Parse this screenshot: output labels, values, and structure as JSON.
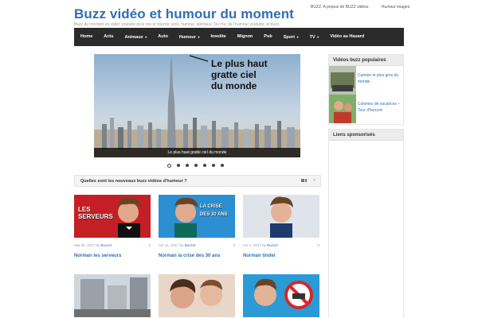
{
  "header": {
    "site_title": "Buzz vidéo et humour du moment",
    "tagline": "Buzz du moment en vidéo youtube pour rire et sourire, actu, humour, animaux. Du rire, de l'humour youtube, et buzz.",
    "top_links": [
      "BUZZ: A propos de BUZZ vidéos",
      "Humour images"
    ]
  },
  "nav": {
    "items": [
      {
        "label": "Home",
        "dropdown": false
      },
      {
        "label": "Actu",
        "dropdown": false
      },
      {
        "label": "Animaux",
        "dropdown": true
      },
      {
        "label": "Auto",
        "dropdown": false
      },
      {
        "label": "Humour",
        "dropdown": true
      },
      {
        "label": "Insolite",
        "dropdown": false
      },
      {
        "label": "Mignon",
        "dropdown": false
      },
      {
        "label": "Pub",
        "dropdown": false
      },
      {
        "label": "Sport",
        "dropdown": true
      },
      {
        "label": "TV",
        "dropdown": true
      },
      {
        "label": "Vidéo au Hasard",
        "dropdown": false
      }
    ],
    "caret": "▾"
  },
  "slider": {
    "callout": [
      "Le plus haut",
      "gratte ciel",
      "du monde"
    ],
    "caption": "Le plus haut gratte ciel du monde",
    "slide_count": 7,
    "active_index": 0
  },
  "section": {
    "title": "Quelles sont les nouveaux buzz vidéos d'humour ?"
  },
  "cards": [
    {
      "date": "Mai 30, 2017",
      "by": "by",
      "author": "Buzzer",
      "comments": "0",
      "title": "Norman les serveurs",
      "overlay": "LES SERVEURS"
    },
    {
      "date": "Avr 21, 2017",
      "by": "by",
      "author": "Buzzer",
      "comments": "0",
      "title": "Norman la crise des 30 ans",
      "overlay": "LA CRISE DES 30 ANS"
    },
    {
      "date": "Avr 1, 2017",
      "by": "by",
      "author": "Buzzer",
      "comments": "0",
      "title": "Norman tinder",
      "overlay": ""
    },
    {
      "date": "",
      "by": "",
      "author": "",
      "comments": "",
      "title": "",
      "overlay": ""
    },
    {
      "date": "",
      "by": "",
      "author": "",
      "comments": "",
      "title": "",
      "overlay": ""
    },
    {
      "date": "",
      "by": "",
      "author": "",
      "comments": "",
      "title": "",
      "overlay": ""
    }
  ],
  "sidebar": {
    "popular_title": "Vidéos buzz populaires",
    "popular": [
      {
        "title": "Camion le plus gros du monde"
      },
      {
        "title": "Colonies de vacances – Tour d'horizon"
      }
    ],
    "sponsored_title": "Liens sponsorisés"
  },
  "colors": {
    "accent": "#2f6fb3",
    "nav_bg": "#2b2b2b"
  }
}
